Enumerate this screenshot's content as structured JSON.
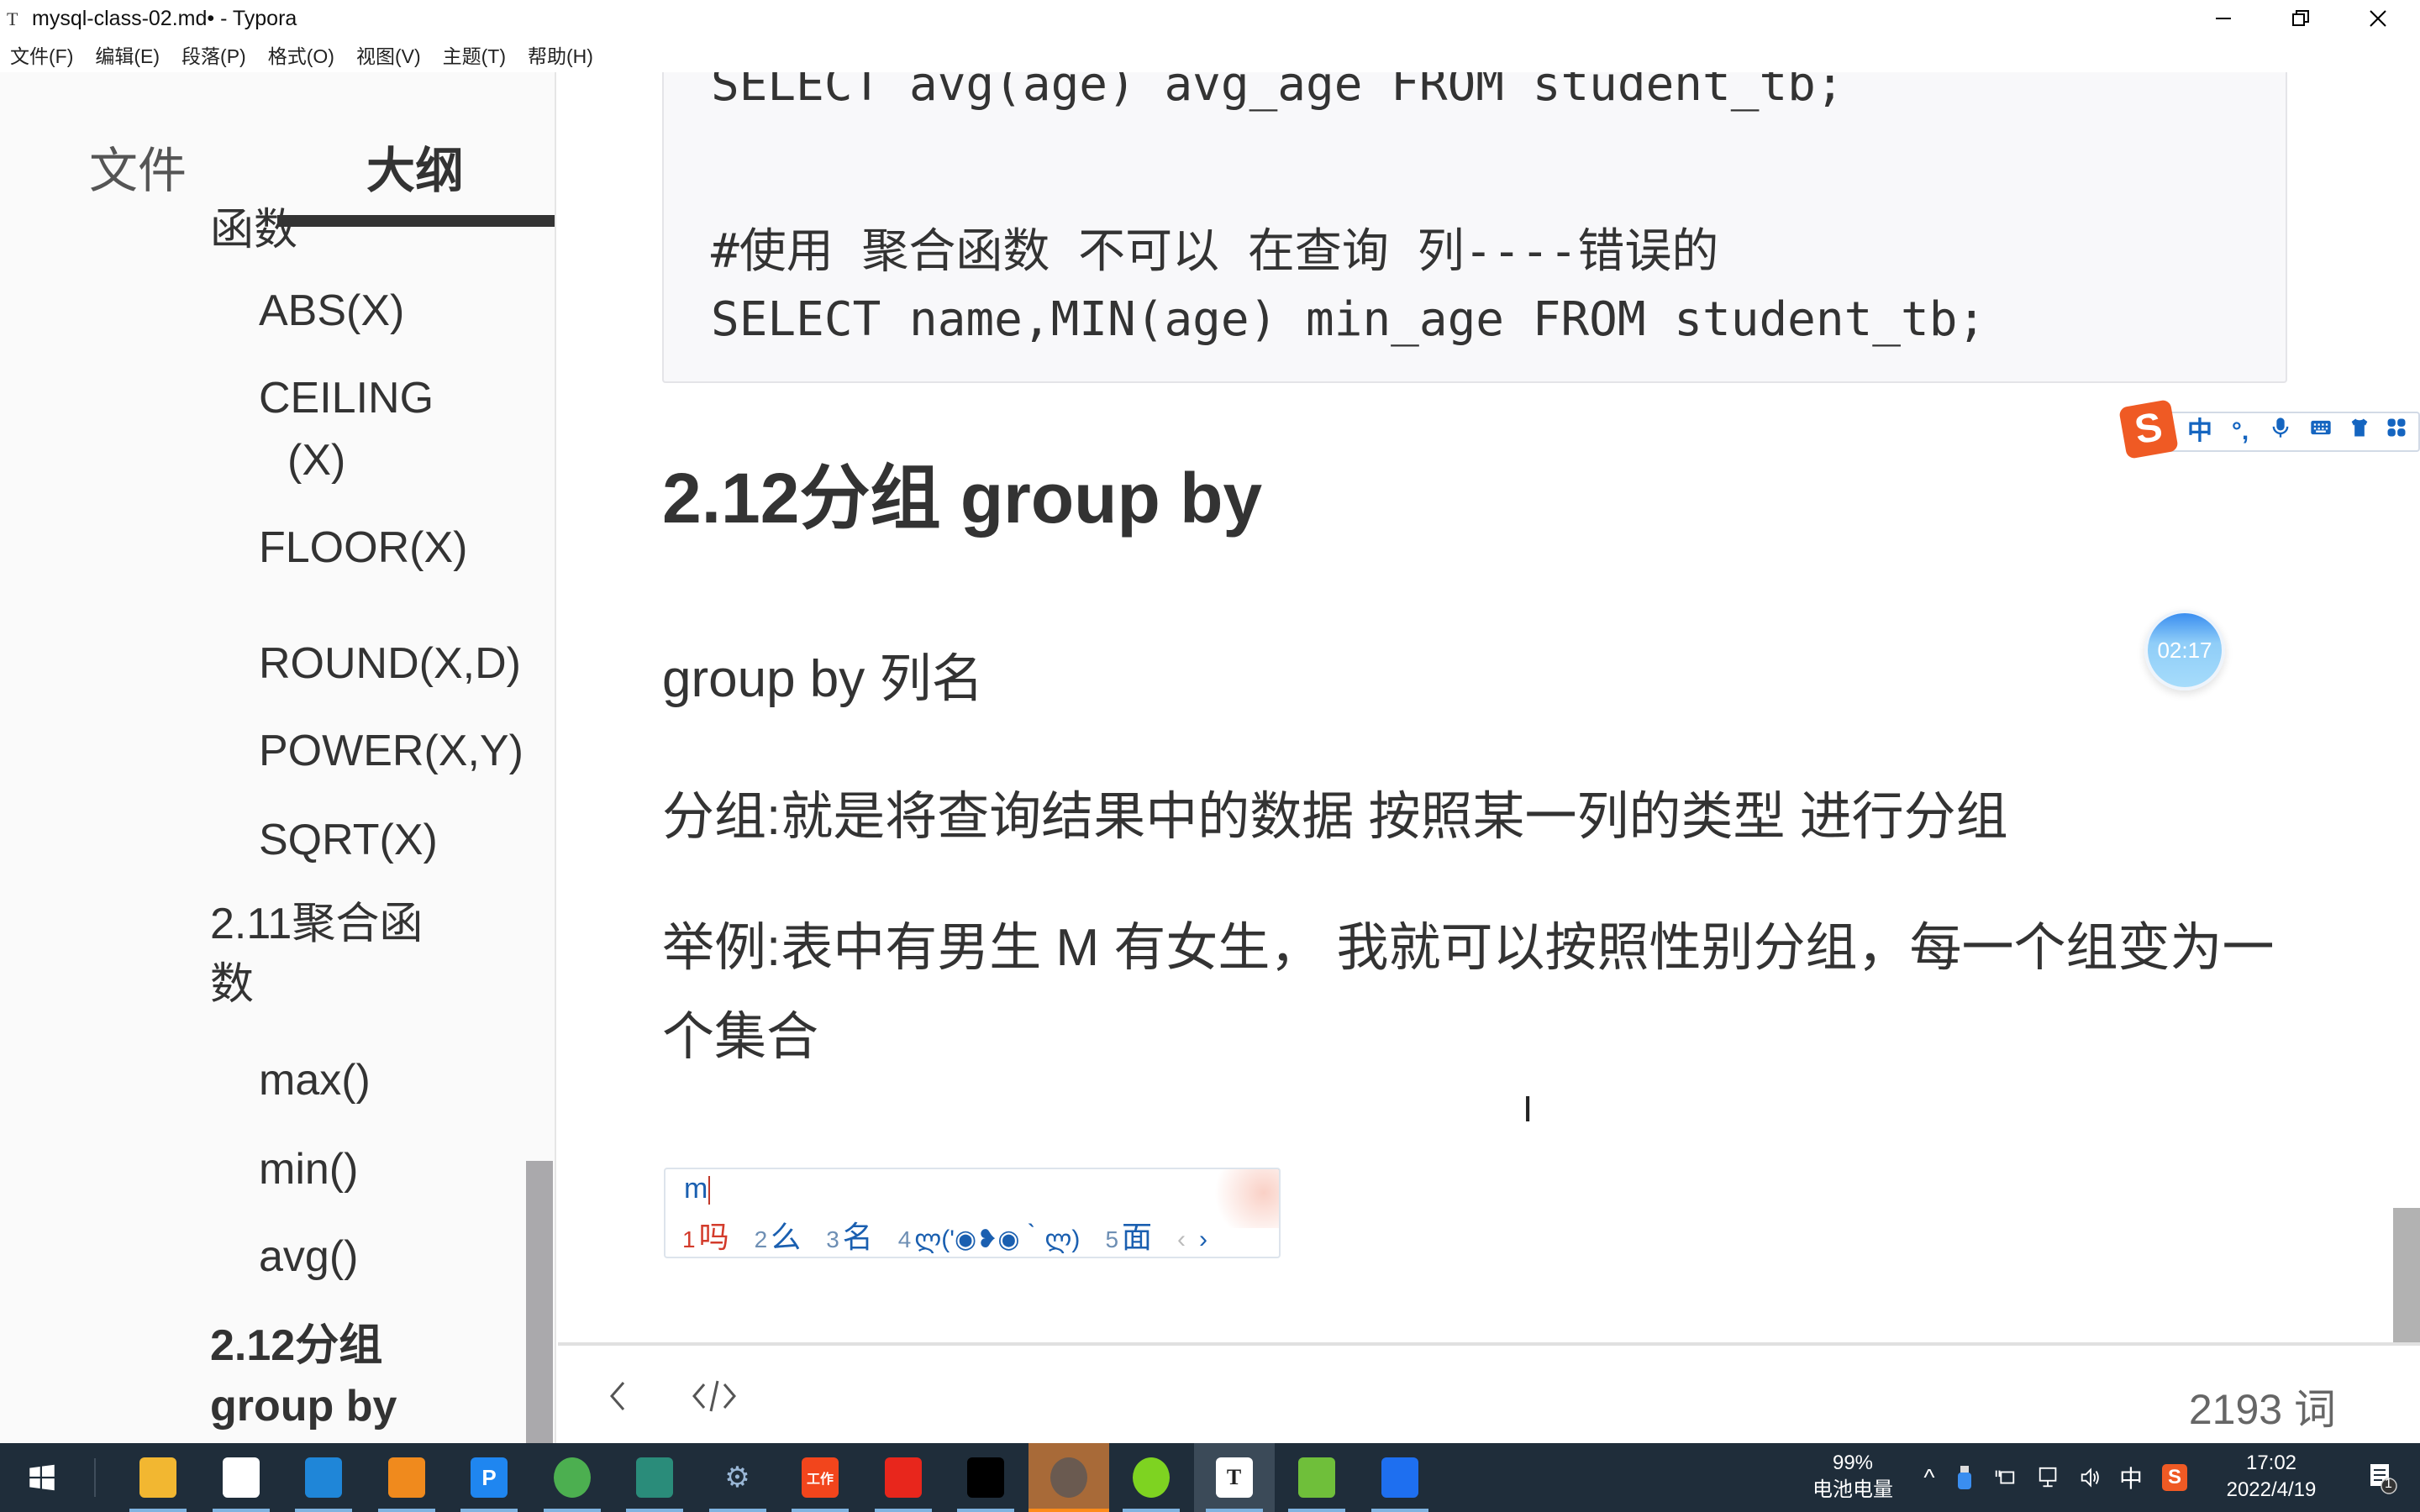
{
  "window": {
    "app_icon": "T",
    "title": "mysql-class-02.md• - Typora",
    "controls": {
      "minimize": "minimize-icon",
      "restore": "restore-icon",
      "close": "close-icon"
    }
  },
  "menubar": {
    "items": [
      "文件(F)",
      "编辑(E)",
      "段落(P)",
      "格式(O)",
      "视图(V)",
      "主题(T)",
      "帮助(H)"
    ]
  },
  "sidebar": {
    "tabs": [
      {
        "label": "文件",
        "active": false
      },
      {
        "label": "大纲",
        "active": true
      }
    ],
    "outline": [
      {
        "label": "函数",
        "level": 3
      },
      {
        "label": "ABS(X)",
        "level": 4
      },
      {
        "label": "CEILING",
        "level": 4
      },
      {
        "label": "(X)",
        "level": 4
      },
      {
        "label": "FLOOR(X)",
        "level": 4
      },
      {
        "label": "ROUND(X,D)",
        "level": 4
      },
      {
        "label": "POWER(X,Y)",
        "level": 4
      },
      {
        "label": "SQRT(X)",
        "level": 4
      },
      {
        "label": "2.11聚合函",
        "level": 3
      },
      {
        "label": "数",
        "level": 3
      },
      {
        "label": "max()",
        "level": 4
      },
      {
        "label": "min()",
        "level": 4
      },
      {
        "label": "avg()",
        "level": 4
      },
      {
        "label": "2.12分组",
        "level": 2
      },
      {
        "label": "group by",
        "level": 2
      }
    ]
  },
  "editor": {
    "code_block": {
      "lines": [
        "SELECT avg(age) avg_age FROM student_tb;",
        "",
        "#使用 聚合函数 不可以 在查询 列----错误的",
        "SELECT name,MIN(age) min_age FROM student_tb;"
      ]
    },
    "heading": "2.12分组 group by",
    "paragraphs": [
      "group by  列名",
      "分组:就是将查询结果中的数据 按照某一列的类型 进行分组",
      "举例:表中有男生 M 有女生， 我就可以按照性别分组，每一个组变为一个集合"
    ],
    "cursor_icon": "I"
  },
  "ime": {
    "input": "m",
    "candidates": [
      {
        "num": "1",
        "text": "吗",
        "active": true
      },
      {
        "num": "2",
        "text": "么",
        "active": false
      },
      {
        "num": "3",
        "text": "名",
        "active": false
      },
      {
        "num": "4",
        "text": "ლ('◉❥◉｀ლ)",
        "active": false
      },
      {
        "num": "5",
        "text": "面",
        "active": false
      }
    ],
    "prev": "‹",
    "next": "›",
    "toolbar": {
      "logo": "S",
      "items": [
        "中",
        "°,",
        "mic-icon",
        "keyboard-icon",
        "skin-icon",
        "toolbox-icon"
      ],
      "mode_label": "中",
      "punct_label": "°,"
    }
  },
  "timer": {
    "value": "02:17"
  },
  "statusbar": {
    "back_icon": "chevron-left-icon",
    "source_icon": "source-code-icon",
    "word_count": "2193 词"
  },
  "taskbar": {
    "apps": [
      {
        "name": "file-explorer",
        "color": "#f2b731"
      },
      {
        "name": "microsoft-store",
        "color": "#ffffff"
      },
      {
        "name": "mail",
        "color": "#1f86d8"
      },
      {
        "name": "search-tool",
        "color": "#f08a1d"
      },
      {
        "name": "p-app",
        "color": "#1f86f0"
      },
      {
        "name": "chrome",
        "color": "#4caf50"
      },
      {
        "name": "notes-app",
        "color": "#2a8c7a"
      },
      {
        "name": "settings-tool",
        "color": "#9ab7d6"
      },
      {
        "name": "work-app",
        "color": "#f2451c"
      },
      {
        "name": "wps-office",
        "color": "#e8261c"
      },
      {
        "name": "terminal",
        "color": "#000000"
      },
      {
        "name": "avatar-app",
        "color": "#a86a38"
      },
      {
        "name": "green-app",
        "color": "#7ed321"
      },
      {
        "name": "typora",
        "color": "#ffffff"
      },
      {
        "name": "notepad-plus",
        "color": "#6fbf3a"
      },
      {
        "name": "security-app",
        "color": "#1e6ff0"
      }
    ],
    "tray": {
      "battery_percent": "99%",
      "battery_label": "电池电量",
      "expand": "^",
      "ime_mode": "中",
      "time": "17:02",
      "date": "2022/4/19",
      "notification_count": "1"
    }
  }
}
